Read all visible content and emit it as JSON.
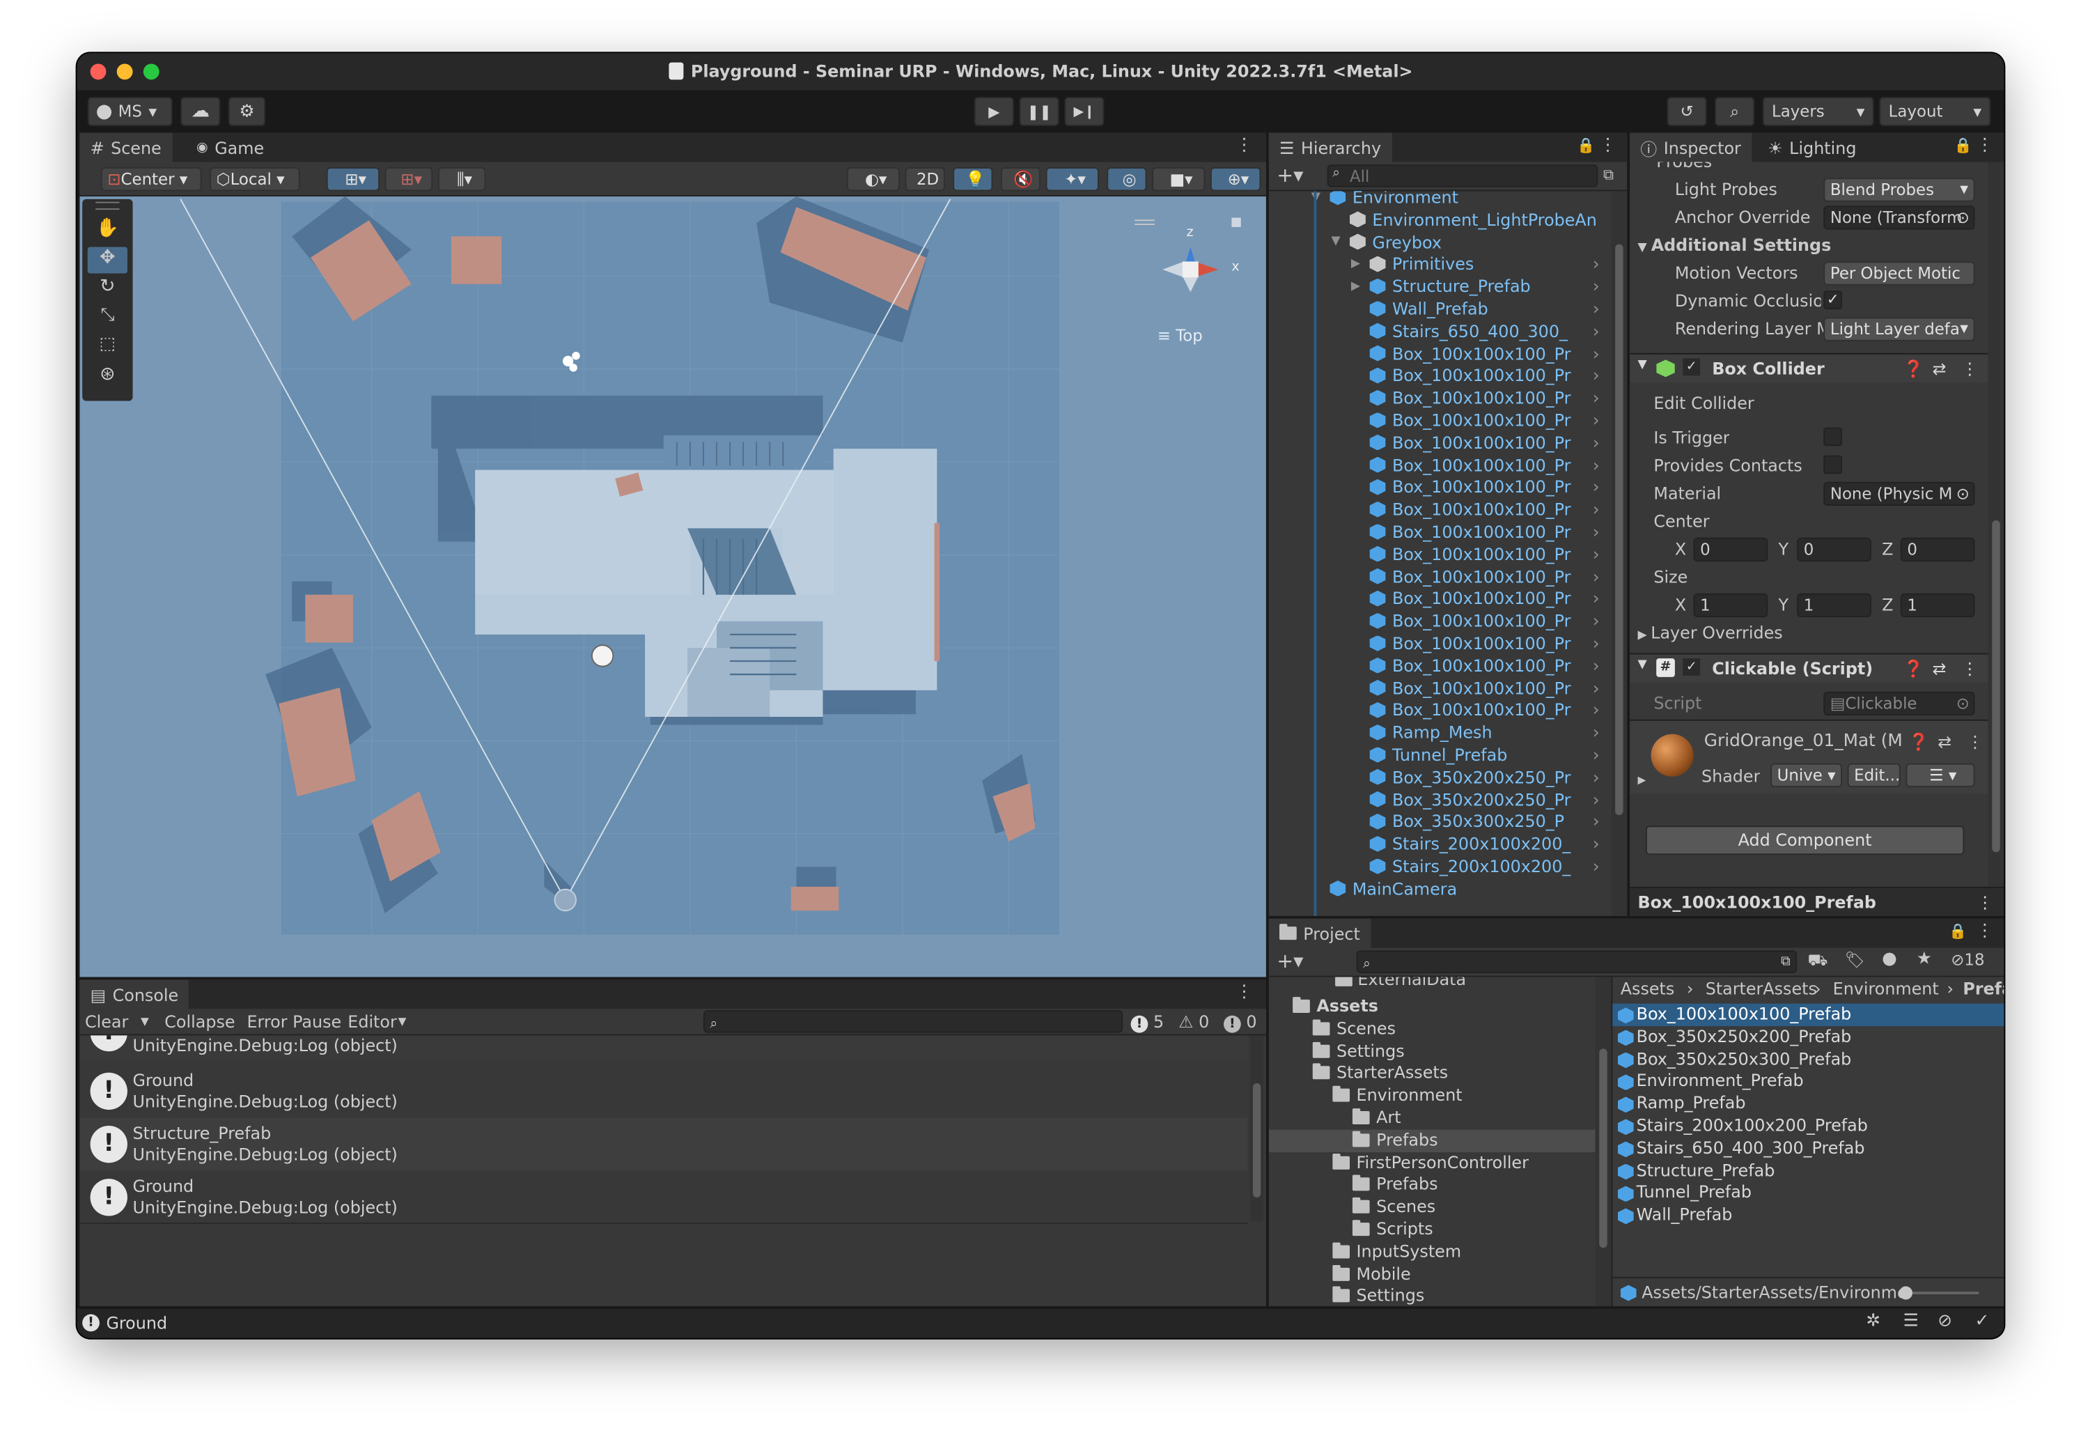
{
  "window": {
    "title": "Playground - Seminar URP - Windows, Mac, Linux - Unity 2022.3.7f1 <Metal>"
  },
  "toolbar": {
    "account": "MS",
    "layers": "Layers",
    "layout": "Layout"
  },
  "scene_panel": {
    "tabs": [
      "Scene",
      "Game"
    ],
    "pivot": "Center",
    "space": "Local",
    "mode_2d": "2D",
    "view_label": "≡ Top",
    "axis_x": "x",
    "axis_z": "z"
  },
  "console": {
    "tab": "Console",
    "clear": "Clear",
    "collapse": "Collapse",
    "error_pause": "Error Pause",
    "editor": "Editor",
    "count_errors": "5",
    "count_warnings": "0",
    "count_messages": "0",
    "partial_top": "UnityEngine.Debug:Log (object)",
    "logs": [
      {
        "title": "Ground",
        "detail": "UnityEngine.Debug:Log (object)"
      },
      {
        "title": "Structure_Prefab",
        "detail": "UnityEngine.Debug:Log (object)"
      },
      {
        "title": "Ground",
        "detail": "UnityEngine.Debug:Log (object)"
      }
    ]
  },
  "status_bar": {
    "text": "Ground"
  },
  "hierarchy": {
    "tab": "Hierarchy",
    "search_placeholder": "All",
    "items": [
      {
        "label": "Environment",
        "depth": 0,
        "icon": "cube",
        "arrow": "open"
      },
      {
        "label": "Environment_LightProbeAn",
        "depth": 1,
        "icon": "cube-outline",
        "arrow": ""
      },
      {
        "label": "Greybox",
        "depth": 1,
        "icon": "cube-outline",
        "arrow": "open"
      },
      {
        "label": "Primitives",
        "depth": 2,
        "icon": "cube-outline",
        "arrow": "closed"
      },
      {
        "label": "Structure_Prefab",
        "depth": 2,
        "icon": "cube",
        "arrow": "closed"
      },
      {
        "label": "Wall_Prefab",
        "depth": 2,
        "icon": "cube",
        "arrow": ""
      },
      {
        "label": "Stairs_650_400_300_",
        "depth": 2,
        "icon": "cube",
        "arrow": ""
      },
      {
        "label": "Box_100x100x100_Pr",
        "depth": 2,
        "icon": "cube",
        "arrow": ""
      },
      {
        "label": "Box_100x100x100_Pr",
        "depth": 2,
        "icon": "cube",
        "arrow": ""
      },
      {
        "label": "Box_100x100x100_Pr",
        "depth": 2,
        "icon": "cube",
        "arrow": ""
      },
      {
        "label": "Box_100x100x100_Pr",
        "depth": 2,
        "icon": "cube",
        "arrow": ""
      },
      {
        "label": "Box_100x100x100_Pr",
        "depth": 2,
        "icon": "cube",
        "arrow": ""
      },
      {
        "label": "Box_100x100x100_Pr",
        "depth": 2,
        "icon": "cube",
        "arrow": ""
      },
      {
        "label": "Box_100x100x100_Pr",
        "depth": 2,
        "icon": "cube",
        "arrow": ""
      },
      {
        "label": "Box_100x100x100_Pr",
        "depth": 2,
        "icon": "cube",
        "arrow": ""
      },
      {
        "label": "Box_100x100x100_Pr",
        "depth": 2,
        "icon": "cube",
        "arrow": ""
      },
      {
        "label": "Box_100x100x100_Pr",
        "depth": 2,
        "icon": "cube",
        "arrow": ""
      },
      {
        "label": "Box_100x100x100_Pr",
        "depth": 2,
        "icon": "cube",
        "arrow": ""
      },
      {
        "label": "Box_100x100x100_Pr",
        "depth": 2,
        "icon": "cube",
        "arrow": ""
      },
      {
        "label": "Box_100x100x100_Pr",
        "depth": 2,
        "icon": "cube",
        "arrow": ""
      },
      {
        "label": "Box_100x100x100_Pr",
        "depth": 2,
        "icon": "cube",
        "arrow": ""
      },
      {
        "label": "Box_100x100x100_Pr",
        "depth": 2,
        "icon": "cube",
        "arrow": ""
      },
      {
        "label": "Box_100x100x100_Pr",
        "depth": 2,
        "icon": "cube",
        "arrow": ""
      },
      {
        "label": "Box_100x100x100_Pr",
        "depth": 2,
        "icon": "cube",
        "arrow": ""
      },
      {
        "label": "Ramp_Mesh",
        "depth": 2,
        "icon": "cube",
        "arrow": ""
      },
      {
        "label": "Tunnel_Prefab",
        "depth": 2,
        "icon": "cube",
        "arrow": ""
      },
      {
        "label": "Box_350x200x250_Pr",
        "depth": 2,
        "icon": "cube",
        "arrow": ""
      },
      {
        "label": "Box_350x200x250_Pr",
        "depth": 2,
        "icon": "cube",
        "arrow": ""
      },
      {
        "label": "Box_350x300x250_P",
        "depth": 2,
        "icon": "cube",
        "arrow": ""
      },
      {
        "label": "Stairs_200x100x200_",
        "depth": 2,
        "icon": "cube",
        "arrow": ""
      },
      {
        "label": "Stairs_200x100x200_",
        "depth": 2,
        "icon": "cube",
        "arrow": ""
      },
      {
        "label": "MainCamera",
        "depth": 0,
        "icon": "cube",
        "arrow": ""
      }
    ]
  },
  "inspector": {
    "tabs": [
      "Inspector",
      "Lighting"
    ],
    "probes_header": "Probes",
    "light_probes_label": "Light Probes",
    "light_probes_value": "Blend Probes",
    "anchor_override_label": "Anchor Override",
    "anchor_override_value": "None (Transform",
    "additional_settings": "Additional Settings",
    "motion_vectors_label": "Motion Vectors",
    "motion_vectors_value": "Per Object Motic",
    "dynamic_occlusion_label": "Dynamic Occlusioi",
    "rendering_layer_label": "Rendering Layer M",
    "rendering_layer_value": "Light Layer defa",
    "box_collider": "Box Collider",
    "edit_collider": "Edit Collider",
    "is_trigger": "Is Trigger",
    "provides_contacts": "Provides Contacts",
    "material_label": "Material",
    "material_value": "None (Physic M",
    "center_label": "Center",
    "center": {
      "x": "0",
      "y": "0",
      "z": "0"
    },
    "size_label": "Size",
    "size": {
      "x": "1",
      "y": "1",
      "z": "1"
    },
    "axis_x": "X",
    "axis_y": "Y",
    "axis_z": "Z",
    "layer_overrides": "Layer Overrides",
    "clickable_script": "Clickable (Script)",
    "script_label": "Script",
    "script_value": "Clickable",
    "material_name": "GridOrange_01_Mat (Mæ",
    "shader_label": "Shader",
    "shader_value": "Unive",
    "edit_button": "Edit...",
    "add_component": "Add Component",
    "footer": "Box_100x100x100_Prefab"
  },
  "project": {
    "tab": "Project",
    "hidden_count": "18",
    "partial_top": "ExternalData",
    "breadcrumb": [
      "Assets",
      "StarterAssets",
      "Environment",
      "Prefab"
    ],
    "tree": [
      {
        "label": "Assets",
        "depth": 0,
        "arrow": "open",
        "bold": true
      },
      {
        "label": "Scenes",
        "depth": 1,
        "arrow": ""
      },
      {
        "label": "Settings",
        "depth": 1,
        "arrow": ""
      },
      {
        "label": "StarterAssets",
        "depth": 1,
        "arrow": "open"
      },
      {
        "label": "Environment",
        "depth": 2,
        "arrow": "open"
      },
      {
        "label": "Art",
        "depth": 3,
        "arrow": "closed"
      },
      {
        "label": "Prefabs",
        "depth": 3,
        "arrow": "",
        "selected": true
      },
      {
        "label": "FirstPersonController",
        "depth": 2,
        "arrow": "open"
      },
      {
        "label": "Prefabs",
        "depth": 3,
        "arrow": ""
      },
      {
        "label": "Scenes",
        "depth": 3,
        "arrow": "closed"
      },
      {
        "label": "Scripts",
        "depth": 3,
        "arrow": ""
      },
      {
        "label": "InputSystem",
        "depth": 2,
        "arrow": ""
      },
      {
        "label": "Mobile",
        "depth": 2,
        "arrow": "closed"
      },
      {
        "label": "Settings",
        "depth": 2,
        "arrow": ""
      }
    ],
    "files": [
      "Box_100x100x100_Prefab",
      "Box_350x250x200_Prefab",
      "Box_350x250x300_Prefab",
      "Environment_Prefab",
      "Ramp_Prefab",
      "Stairs_200x100x200_Prefab",
      "Stairs_650_400_300_Prefab",
      "Structure_Prefab",
      "Tunnel_Prefab",
      "Wall_Prefab"
    ],
    "path": "Assets/StarterAssets/Environmen"
  },
  "colors": {
    "accent": "#2c5d87",
    "link": "#7cc0f5",
    "scene_bg": "#6e93b3",
    "box": "#c08f84"
  }
}
